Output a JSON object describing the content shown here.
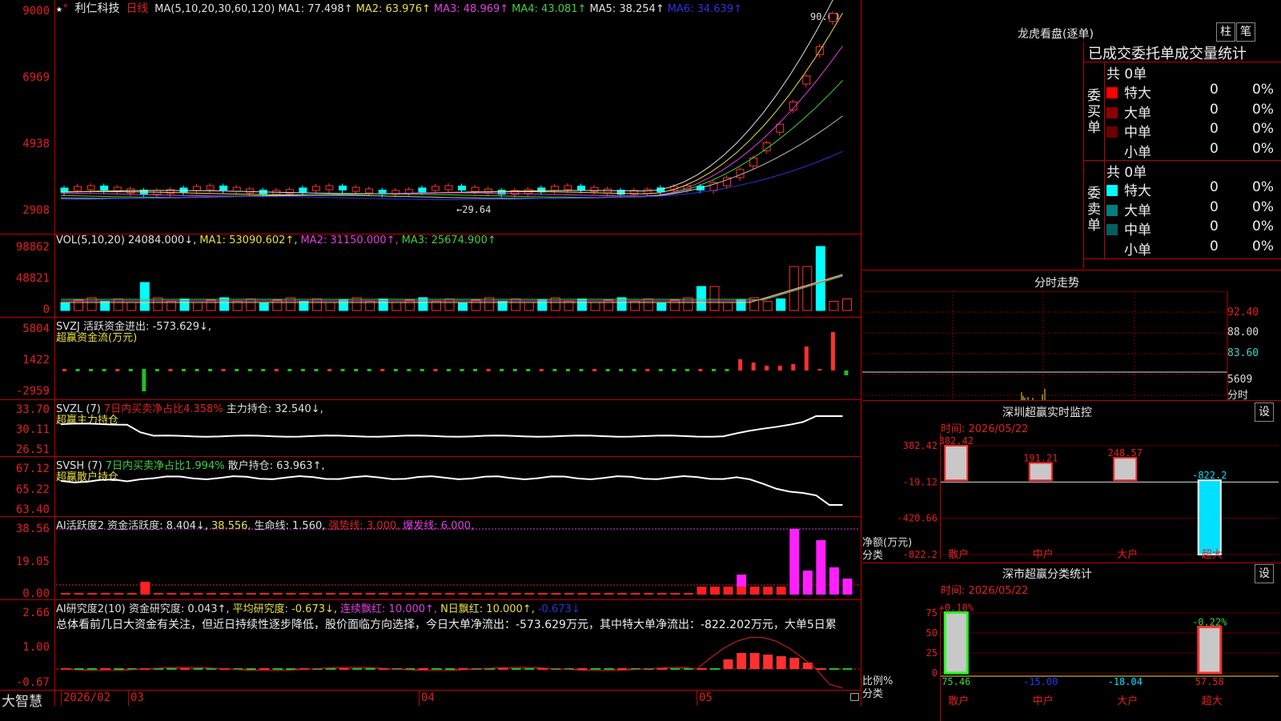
{
  "stock": {
    "name": "利仁科技",
    "period": "日线",
    "ma_legend": [
      {
        "text": "MA(5,10,20,30,60,120)",
        "color": "#e0e0e0"
      },
      {
        "text": "MA1: 77.498↑",
        "color": "#e0e0e0"
      },
      {
        "text": "MA2: 63.976↑",
        "color": "#e8e040"
      },
      {
        "text": "MA3: 48.969↑",
        "color": "#e040e0"
      },
      {
        "text": "MA4: 43.081↑",
        "color": "#40d040"
      },
      {
        "text": "MA5: 38.254↑",
        "color": "#e0e0e0"
      },
      {
        "text": "MA6: 34.639↑",
        "color": "#3030e0"
      }
    ],
    "y_labels": [
      "9000",
      "6969",
      "4938",
      "2908"
    ],
    "high_label": "90.00",
    "low_label": "←29.64"
  },
  "vol": {
    "legend": [
      {
        "text": "VOL(5,10,20)",
        "color": "#e0e0e0"
      },
      {
        "text": "24084.000↓,",
        "color": "#e0e0e0"
      },
      {
        "text": "MA1: 53090.602↑,",
        "color": "#e8e040"
      },
      {
        "text": "MA2: 31150.000↑,",
        "color": "#e040e0"
      },
      {
        "text": "MA3: 25674.900↑",
        "color": "#40d040"
      }
    ],
    "y_labels": [
      "98862",
      "48821",
      "0"
    ]
  },
  "svzj": {
    "legend": [
      {
        "text": "SVZJ  活跃资金进出: -573.629↓,",
        "color": "#e0e0e0"
      }
    ],
    "subtitle": "超赢资金流(万元)",
    "y_labels": [
      "5804",
      "1422",
      "-2959"
    ]
  },
  "svzl": {
    "legend": [
      {
        "text": "SVZL (7)",
        "color": "#e0e0e0"
      },
      {
        "text": "7日内买卖净占比4.358%",
        "color": "#e02020"
      },
      {
        "text": "主力持仓: 32.540↓,",
        "color": "#e0e0e0"
      }
    ],
    "subtitle": "超赢主力持仓",
    "y_labels": [
      "33.70",
      "30.11",
      "26.51"
    ]
  },
  "svsh": {
    "legend": [
      {
        "text": "SVSH (7)",
        "color": "#e0e0e0"
      },
      {
        "text": "7日内买卖净占比1.994%",
        "color": "#40d040"
      },
      {
        "text": "散户持仓: 63.963↑,",
        "color": "#e0e0e0"
      }
    ],
    "subtitle": "超赢散户持仓",
    "y_labels": [
      "67.12",
      "65.22",
      "63.40"
    ]
  },
  "ai_active": {
    "legend": [
      {
        "text": "AI活跃度2 资金活跃度: 8.404↓,",
        "color": "#e0e0e0"
      },
      {
        "text": "38.556,",
        "color": "#e8e040"
      },
      {
        "text": "生命线: 1.560,",
        "color": "#e0e0e0"
      },
      {
        "text": "强势线: 3.000,",
        "color": "#e02020"
      },
      {
        "text": "爆发线: 6.000,",
        "color": "#e040e0"
      }
    ],
    "y_labels": [
      "38.56",
      "19.05",
      "0.00"
    ]
  },
  "ai_research": {
    "legend": [
      {
        "text": "AI研究度2(10) 资金研究度: 0.043↑,",
        "color": "#e0e0e0"
      },
      {
        "text": "平均研究度: -0.673↓,",
        "color": "#e8e040"
      },
      {
        "text": "连续飘红: 10.000↑,",
        "color": "#e040e0"
      },
      {
        "text": "N日飘红: 10.000↑,",
        "color": "#e8e040"
      },
      {
        "text": "-0.673↓",
        "color": "#3030e0"
      }
    ],
    "comment": "总体看前几日大资金有关注，但近日持续性逐步降低，股价面临方向选择，今日大单净流出：-573.629万元，其中特大单净流出：-822.202万元，大单5日累",
    "y_labels": [
      "2.66",
      "1.00",
      "-0.67"
    ]
  },
  "x_axis": {
    "brand": "大智慧",
    "labels": [
      "2026/02",
      "03",
      "04",
      "05"
    ]
  },
  "dragon": {
    "title": "龙虎看盘(逐单)",
    "btn_bar": "柱",
    "btn_line": "笔",
    "heading": "已成交委托单成交量统计",
    "buy": {
      "side_label": "委买单",
      "total": "共 0单",
      "rows": [
        {
          "label": "特大",
          "count": "0",
          "pct": "0%",
          "color": "#ff0000"
        },
        {
          "label": "大单",
          "count": "0",
          "pct": "0%",
          "color": "#8b0000"
        },
        {
          "label": "中单",
          "count": "0",
          "pct": "0%",
          "color": "#6b0000"
        },
        {
          "label": "小单",
          "count": "0",
          "pct": "0%",
          "color": "#000000"
        }
      ]
    },
    "sell": {
      "side_label": "委卖单",
      "total": "共 0单",
      "rows": [
        {
          "label": "特大",
          "count": "0",
          "pct": "0%",
          "color": "#00ffff"
        },
        {
          "label": "大单",
          "count": "0",
          "pct": "0%",
          "color": "#007f7f"
        },
        {
          "label": "中单",
          "count": "0",
          "pct": "0%",
          "color": "#006060"
        },
        {
          "label": "小单",
          "count": "0",
          "pct": "0%",
          "color": "#000000"
        }
      ]
    }
  },
  "intraday": {
    "title": "分时走势",
    "y_labels": [
      "92.40",
      "88.00",
      "83.60"
    ],
    "vol_label": "5609",
    "unit_label": "分时"
  },
  "sz_monitor": {
    "title": "深圳超赢实时监控",
    "btn": "设",
    "time": "时间: 2026/05/22",
    "y_labels": [
      "382.42",
      "-19.12",
      "-420.66",
      "-822.2"
    ],
    "axis_title": "净额(万元)",
    "axis_sub": "分类",
    "chart_data": {
      "type": "bar",
      "categories": [
        "散户",
        "中户",
        "大户",
        "超大"
      ],
      "values": [
        382.42,
        191.21,
        248.57,
        -822.2
      ],
      "value_labels": [
        "382.42",
        "191.21",
        "248.57",
        "-822.2"
      ],
      "ylim": [
        -822.2,
        382.42
      ]
    }
  },
  "sz_class": {
    "title": "深市超赢分类统计",
    "btn": "设",
    "time": "时间: 2026/05/22",
    "y_labels": [
      "75",
      "50",
      "25",
      "0"
    ],
    "axis_title": "比例%",
    "axis_sub": "分类",
    "chart_data": {
      "type": "bar",
      "categories": [
        "散户",
        "中户",
        "大户",
        "超大"
      ],
      "series": [
        {
          "name": "比例",
          "values": [
            75.46,
            -15.0,
            -18.04,
            57.58
          ]
        },
        {
          "values": [
            0.1,
            0,
            0,
            -0.22
          ]
        }
      ],
      "value_labels": [
        "75.46",
        "-15.00",
        "-18.04",
        "57.58"
      ],
      "change_labels": [
        "+0.10%",
        "",
        "",
        "-0.22%"
      ],
      "ylim": [
        0,
        75
      ]
    }
  }
}
